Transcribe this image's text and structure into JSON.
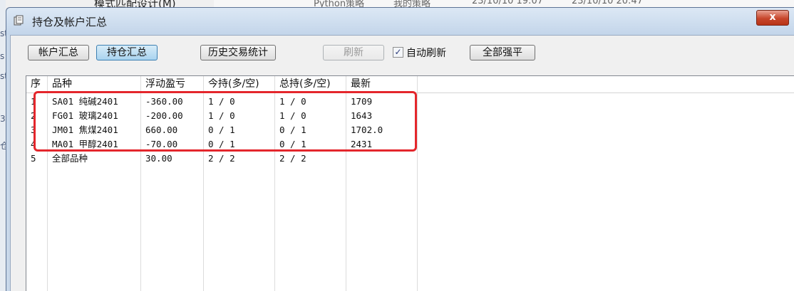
{
  "background": {
    "menu_text": "模式匹配设计(M)",
    "table_cells": [
      "Python策略",
      "我的策略",
      "23/10/10 19:07",
      "23/10/10 20:47"
    ],
    "left_chars": [
      "st",
      "s",
      "st",
      "3",
      "仓"
    ]
  },
  "window": {
    "title": "持仓及帐户汇总",
    "close_label": "x"
  },
  "toolbar": {
    "account_summary": "帐户汇总",
    "position_summary": "持仓汇总",
    "history_stats": "历史交易统计",
    "refresh": "刷新",
    "auto_refresh_label": "自动刷新",
    "auto_refresh_checked": true,
    "close_all": "全部强平"
  },
  "table": {
    "columns": [
      "序",
      "品种",
      "浮动盈亏",
      "今持(多/空)",
      "总持(多/空)",
      "最新"
    ],
    "rows": [
      [
        "1",
        "SA01 纯碱2401",
        "-360.00",
        "1 / 0",
        "1 / 0",
        "1709"
      ],
      [
        "2",
        "FG01 玻璃2401",
        "-200.00",
        "1 / 0",
        "1 / 0",
        "1643"
      ],
      [
        "3",
        "JM01 焦煤2401",
        "660.00",
        "0 / 1",
        "0 / 1",
        "1702.0"
      ],
      [
        "4",
        "MA01 甲醇2401",
        "-70.00",
        "0 / 1",
        "0 / 1",
        "2431"
      ],
      [
        "5",
        "全部品种",
        "30.00",
        "2 / 2",
        "2 / 2",
        ""
      ]
    ]
  },
  "colors": {
    "highlight": "#e4262c",
    "titlebar": "#c9d8ea",
    "close_button": "#c7462b"
  }
}
